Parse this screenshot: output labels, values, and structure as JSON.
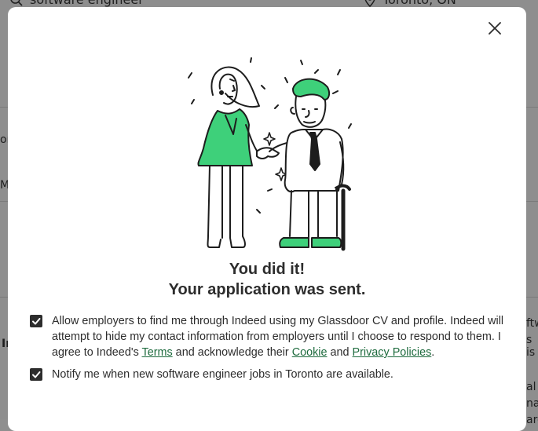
{
  "background": {
    "search_query": "software engineer",
    "search_location": "Toronto, ON",
    "fragments": [
      "or",
      "M",
      "In",
      "ftw",
      "s is",
      "al",
      "na",
      "are"
    ]
  },
  "modal": {
    "close_label": "Close",
    "title_line1": "You did it!",
    "title_line2": "Your application was sent.",
    "consent1": {
      "checked": true,
      "text_before": "Allow employers to find me through Indeed using my Glassdoor CV and profile. Indeed will attempt to hide my contact information from employers until I choose to respond to them. I agree to Indeed's ",
      "terms_link": "Terms",
      "text_middle": " and acknowledge their ",
      "cookie_link": "Cookie",
      "text_and": " and ",
      "privacy_link": "Privacy Policies",
      "text_after": "."
    },
    "consent2": {
      "checked": true,
      "text": "Notify me when new software engineer jobs in Toronto are available."
    }
  },
  "colors": {
    "accent_green": "#3ed07a",
    "link_green": "#1e6b3e",
    "text_dark": "#2d2d2d",
    "overlay": "#8e8e8e"
  }
}
